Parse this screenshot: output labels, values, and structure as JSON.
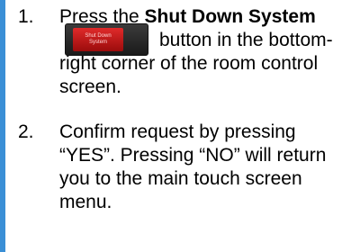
{
  "colors": {
    "accent_bar": "#3a8fd6",
    "button_red": "#c81a1a",
    "button_frame": "#2a2a2a"
  },
  "steps": [
    {
      "number": "1.",
      "pre": "Press the ",
      "bold": "Shut Down System",
      "post": "button in the bottom-right corner of the room control screen.",
      "button": {
        "line1": "Shut Down",
        "line2": "System"
      }
    },
    {
      "number": "2.",
      "text": "Confirm request by pressing “YES”. Pressing “NO” will return you to the main touch screen menu."
    }
  ]
}
